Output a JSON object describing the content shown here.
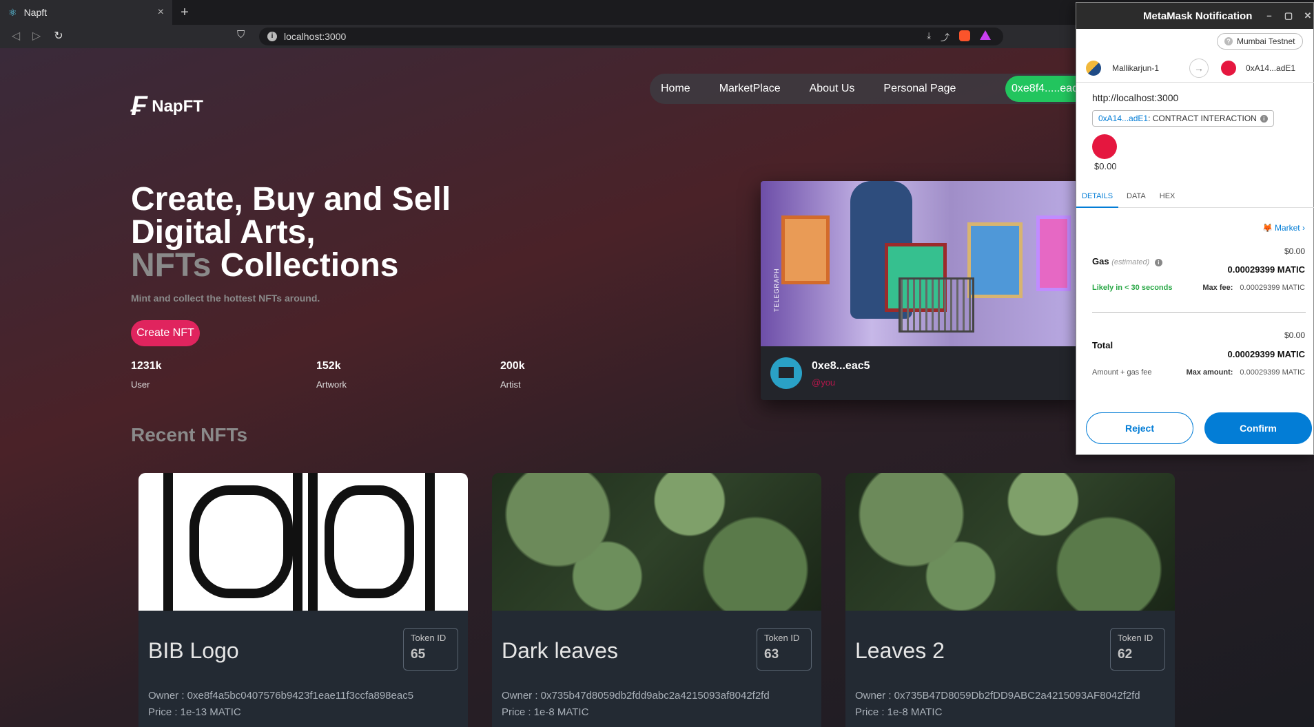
{
  "browser": {
    "tab_title": "Napft",
    "tab_close": "×",
    "new_tab": "+",
    "url": "localhost:3000"
  },
  "site": {
    "brand": "NapFT",
    "nav": [
      "Home",
      "MarketPlace",
      "About Us",
      "Personal Page"
    ],
    "wallet_button": "0xe8f4.....eac5",
    "hero": {
      "line1": "Create, Buy and Sell",
      "line2": "Digital Arts,",
      "line3_faded": "NFTs",
      "line3_rest": " Collections"
    },
    "subtitle": "Mint and collect the hottest NFTs around.",
    "create_button": "Create NFT",
    "stats": [
      {
        "value": "1231k",
        "label": "User"
      },
      {
        "value": "152k",
        "label": "Artwork"
      },
      {
        "value": "200k",
        "label": "Artist"
      }
    ],
    "feature": {
      "owner": "0xe8...eac5",
      "handle": "@you",
      "watermark": "TELEGRAPH"
    },
    "recent_title": "Recent NFTs",
    "nfts": [
      {
        "title": "BIB Logo",
        "token_label": "Token ID",
        "token_id": "65",
        "owner": "Owner : 0xe8f4a5bc0407576b9423f1eae11f3ccfa898eac5",
        "price": "Price : 1e-13 MATIC"
      },
      {
        "title": "Dark leaves",
        "token_label": "Token ID",
        "token_id": "63",
        "owner": "Owner : 0x735b47d8059db2fdd9abc2a4215093af8042f2fd",
        "price": "Price : 1e-8 MATIC"
      },
      {
        "title": "Leaves 2",
        "token_label": "Token ID",
        "token_id": "62",
        "owner": "Owner : 0x735B47D8059Db2fDD9ABC2a4215093AF8042f2fd",
        "price": "Price : 1e-8 MATIC"
      }
    ]
  },
  "metamask": {
    "window_title": "MetaMask Notification",
    "network": "Mumbai Testnet",
    "from_account": "Mallikarjun-1",
    "to_account": "0xA14...adE1",
    "origin": "http://localhost:3000",
    "contract_address": "0xA14...adE1",
    "contract_label": " : CONTRACT INTERACTION",
    "amount": "$0.00",
    "tabs": [
      "DETAILS",
      "DATA",
      "HEX"
    ],
    "market_link": "Market",
    "gas": {
      "label": "Gas",
      "estimated": "(estimated)",
      "fiat": "$0.00",
      "value": "0.00029399 MATIC",
      "likely": "Likely in < 30 seconds",
      "max_fee_label": "Max fee:",
      "max_fee": "0.00029399 MATIC"
    },
    "total": {
      "label": "Total",
      "fiat": "$0.00",
      "value": "0.00029399 MATIC",
      "amount_gas": "Amount + gas fee",
      "max_amount_label": "Max amount:",
      "max_amount": "0.00029399 MATIC"
    },
    "reject": "Reject",
    "confirm": "Confirm"
  }
}
